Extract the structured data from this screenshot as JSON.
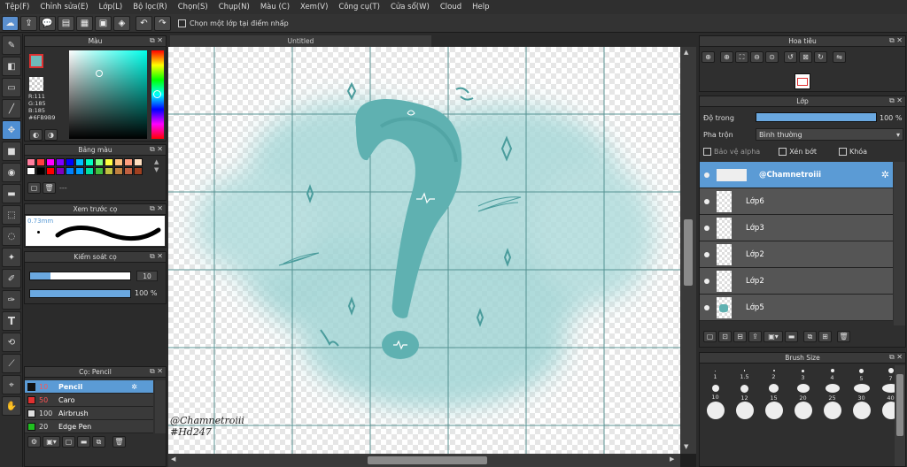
{
  "menu": [
    "Tệp(F)",
    "Chỉnh sửa(E)",
    "Lớp(L)",
    "Bộ lọc(R)",
    "Chọn(S)",
    "Chụp(N)",
    "Màu (C)",
    "Xem(V)",
    "Công cụ(T)",
    "Cửa sổ(W)",
    "Cloud",
    "Help"
  ],
  "toolbar": {
    "select_layer_label": "Chọn một lớp tại điểm nhấp"
  },
  "color_panel": {
    "title": "Màu",
    "r": "R:111",
    "g": "G:185",
    "b": "B:185",
    "hex": "#6FB9B9",
    "current_color": "#6FB9B9"
  },
  "palette_panel": {
    "title": "Bảng màu",
    "dash": "---",
    "colors": [
      "#ff7f9f",
      "#ff3f3f",
      "#ff00ff",
      "#8000ff",
      "#0000ff",
      "#00c0ff",
      "#00ffc0",
      "#80ff80",
      "#ffff40",
      "#ffbf7f",
      "#ff9f7f",
      "#ffdfc0",
      "#ffffff",
      "#000000",
      "#ff0000",
      "#8000c0",
      "#0080ff",
      "#00a0ff",
      "#00e0a0",
      "#40c040",
      "#c0c040",
      "#c08040",
      "#c06040",
      "#a04020"
    ]
  },
  "preview_panel": {
    "title": "Xem trước cọ",
    "size": "0.73mm"
  },
  "brush_control": {
    "title": "Kiểm soát cọ",
    "size": "10",
    "opacity": "100 %",
    "size_fraction": 0.2,
    "opacity_fraction": 1.0
  },
  "brush_panel": {
    "title": "Cọ: Pencil",
    "items": [
      {
        "size": "10",
        "name": "Pencil",
        "color": "#111111",
        "selected": true
      },
      {
        "size": "50",
        "name": "Caro",
        "color": "#e03030",
        "selected": false
      },
      {
        "size": "100",
        "name": "Airbrush",
        "color": "#e0e0e0",
        "selected": false
      },
      {
        "size": "20",
        "name": "Edge Pen",
        "color": "#20c020",
        "selected": false
      }
    ]
  },
  "canvas": {
    "tab_title": "Untitled",
    "signature1": "@Chamnetroiii",
    "signature2": "#Hd247"
  },
  "navigator": {
    "title": "Hoa tiêu"
  },
  "layer_panel": {
    "title": "Lớp",
    "opacity_label": "Độ trong",
    "opacity_value": "100 %",
    "blend_label": "Pha trộn",
    "blend_value": "Bình thường",
    "protect_alpha": "Bảo vệ alpha",
    "clipping": "Xén bớt",
    "lock": "Khóa",
    "layers": [
      {
        "name": "@Chamnetroiii",
        "selected": true
      },
      {
        "name": "Lớp6",
        "selected": false
      },
      {
        "name": "Lớp3",
        "selected": false
      },
      {
        "name": "Lớp2",
        "selected": false
      },
      {
        "name": "Lớp2",
        "selected": false
      },
      {
        "name": "Lớp5",
        "selected": false
      }
    ]
  },
  "brush_size_panel": {
    "title": "Brush Size",
    "sizes": [
      "1",
      "1.5",
      "2",
      "3",
      "4",
      "5",
      "7",
      "10",
      "12",
      "15",
      "20",
      "25",
      "30",
      "40"
    ]
  }
}
